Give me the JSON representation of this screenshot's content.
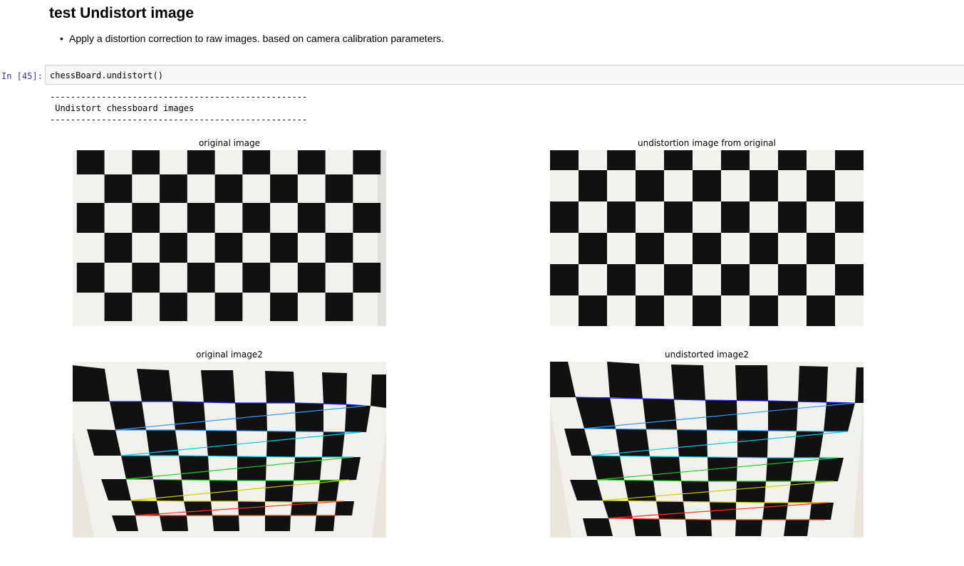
{
  "notebook": {
    "heading": "test Undistort image",
    "bullets": [
      "Apply a distortion correction to raw images. based on camera calibration parameters."
    ],
    "cell": {
      "prompt": "In [45]:",
      "code": "chessBoard.undistort()"
    },
    "output": {
      "stdout": "--------------------------------------------------\n Undistort chessboard images\n--------------------------------------------------"
    },
    "figure": {
      "subplots": [
        {
          "title": "original image"
        },
        {
          "title": "undistortion image from original"
        },
        {
          "title": "original image2"
        },
        {
          "title": "undistorted image2"
        }
      ]
    }
  }
}
